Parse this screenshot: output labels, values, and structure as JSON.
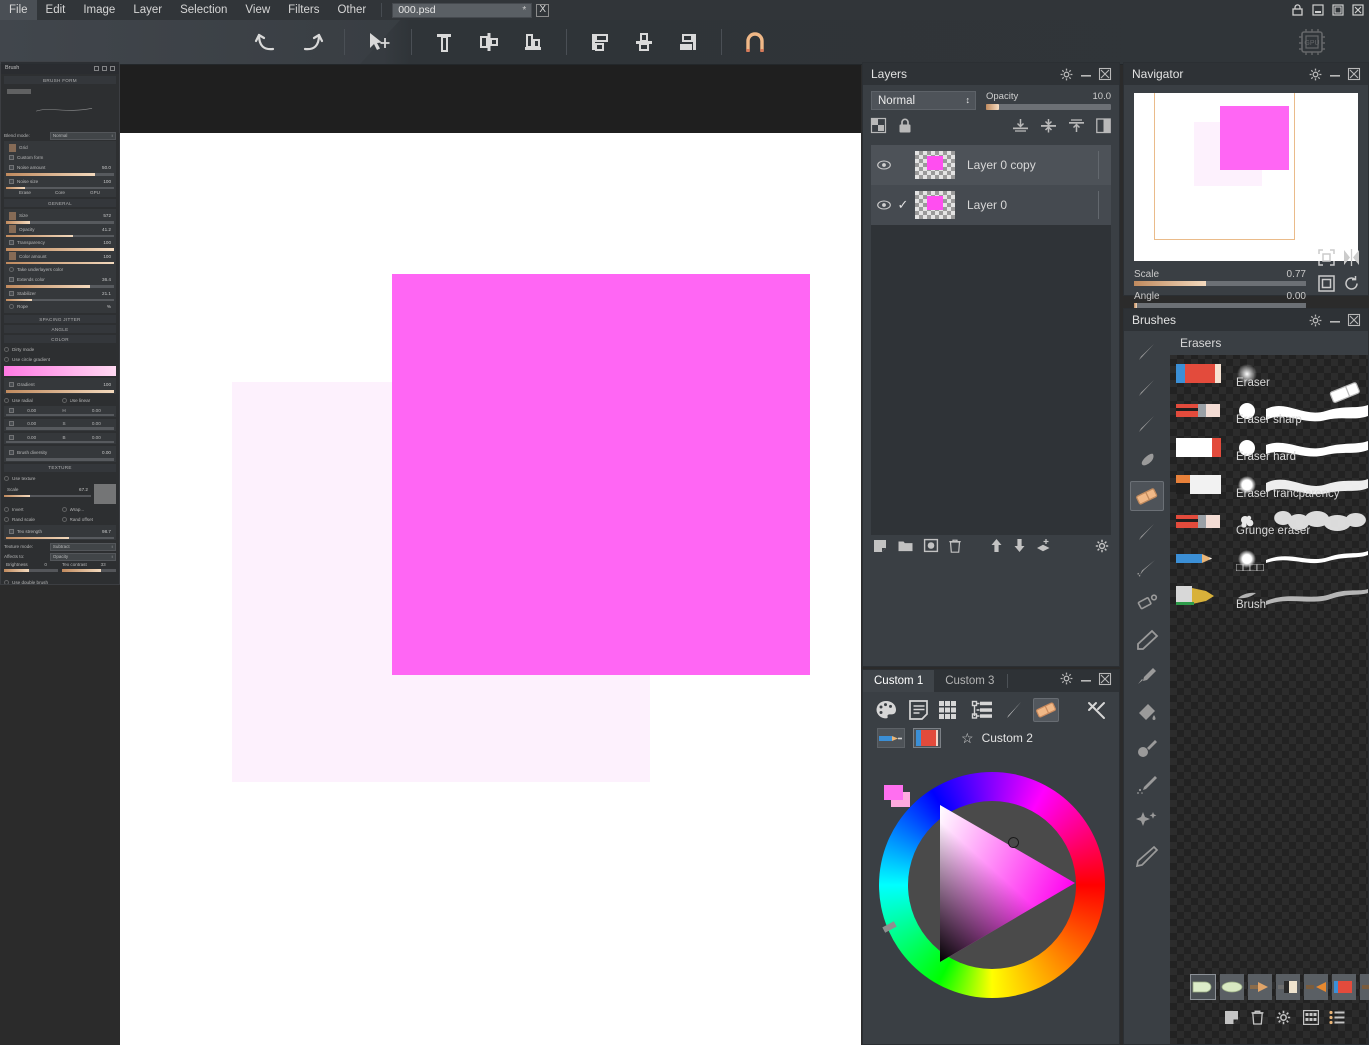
{
  "menu": {
    "items": [
      "File",
      "Edit",
      "Image",
      "Layer",
      "Selection",
      "View",
      "Filters",
      "Other"
    ],
    "document_tab": {
      "filename": "000.psd",
      "modified_marker": "*",
      "close_label": "X"
    }
  },
  "window_controls": {
    "lock": "lock-icon",
    "minimize": "minimize-icon",
    "maximize": "maximize-icon",
    "close": "close-icon"
  },
  "toolbar": {
    "buttons": [
      {
        "name": "undo",
        "label": "Undo"
      },
      {
        "name": "redo",
        "label": "Redo"
      },
      {
        "name": "move-tool",
        "label": "Move"
      },
      {
        "name": "align-left",
        "label": "Align left"
      },
      {
        "name": "align-center-horizontal",
        "label": "Align center horizontally"
      },
      {
        "name": "align-bottom",
        "label": "Align bottom"
      },
      {
        "name": "distribute-left",
        "label": "Distribute left"
      },
      {
        "name": "distribute-center",
        "label": "Distribute center"
      },
      {
        "name": "distribute-right",
        "label": "Distribute right"
      },
      {
        "name": "magnet-snap",
        "label": "Snap"
      }
    ],
    "gpu_badge": "GPU"
  },
  "canvas": {
    "background": "#ffffff",
    "outside_color": "#1f1f1f",
    "shapes": [
      {
        "name": "faded-pink-square",
        "color": "#fdf1fd"
      },
      {
        "name": "magenta-square",
        "color": "#ff66f4"
      }
    ]
  },
  "brush_panel": {
    "title": "Brush",
    "sections": {
      "brush_form": "BRUSH FORM",
      "general": "GENERAL",
      "spacing": "SPACING JITTER",
      "angle": "ANGLE",
      "color": "COLOR",
      "texture": "TEXTURE"
    },
    "blend_mode_label": "Blend mode:",
    "blend_mode_value": "Normal",
    "grid_label": "Grid",
    "custom_form_label": "Custom form",
    "rows_form": [
      {
        "label": "Noise amount",
        "value": "50.0"
      },
      {
        "label": "Noise size",
        "value": "100"
      }
    ],
    "form_buttons": [
      "Erase",
      "Core",
      "GPU"
    ],
    "general_rows": [
      {
        "label": "Size",
        "value": "572"
      },
      {
        "label": "Opacity",
        "value": "41.2"
      },
      {
        "label": "Transparency",
        "value": "100"
      },
      {
        "label": "Color amount",
        "value": "100"
      },
      {
        "label": "Take underlayers color",
        "value": ""
      },
      {
        "label": "Extends color",
        "value": "36.4"
      },
      {
        "label": "Stabilizer",
        "value": "21.1"
      },
      {
        "label": "Rope",
        "value": "%"
      }
    ],
    "color_rows": [
      {
        "label": "Dirty mode",
        "value": ""
      },
      {
        "label": "Use circle gradient",
        "value": ""
      },
      {
        "label": "Gradient",
        "value": "100"
      }
    ],
    "color_modes": [
      "Use radial",
      "Use linear"
    ],
    "hsv_rows": [
      {
        "min": "0.00",
        "channel": "H",
        "max": "0.00"
      },
      {
        "min": "0.00",
        "channel": "S",
        "max": "0.00"
      },
      {
        "min": "0.00",
        "channel": "B",
        "max": "0.00"
      },
      {
        "label": "Brush diversity",
        "value": "0.00"
      }
    ],
    "texture_rows": [
      {
        "label": "Use texture",
        "value": ""
      },
      {
        "label": "Scale",
        "value": "67.2"
      },
      {
        "label": "Tex strength",
        "value": "98.7"
      }
    ],
    "texture_checks": [
      "Invert",
      "Wrap...",
      "Rand scale",
      "Rand offset"
    ],
    "texture_mode_label": "Texture mode:",
    "texture_mode_value": "Subtract",
    "affects_label": "Affects to:",
    "affects_value": "Opacity",
    "brightness_label": "Brightness",
    "brightness_value": "0",
    "contrast_label": "Tex contrast",
    "contrast_value": "33",
    "double_brush_label": "Use double brush"
  },
  "layers": {
    "title": "Layers",
    "blend_mode": "Normal",
    "opacity_label": "Opacity",
    "opacity_value": "10.0",
    "opacity_percent": 10,
    "tool_icons": [
      "transparency-lock-icon",
      "lock-icon",
      "merge-down-icon",
      "merge-selected-icon",
      "merge-up-icon",
      "split-icon"
    ],
    "rows": [
      {
        "name": "Layer 0 copy",
        "visible": true,
        "checked": false,
        "selected": true
      },
      {
        "name": "Layer 0",
        "visible": true,
        "checked": true,
        "selected": false
      }
    ],
    "footer_icons": [
      "new-layer-icon",
      "new-folder-icon",
      "new-mask-icon",
      "delete-layer-icon",
      "move-up-icon",
      "move-down-icon",
      "duplicate-layer-icon",
      "gear-icon"
    ]
  },
  "custom_panel": {
    "tabs": [
      {
        "label": "Custom 1",
        "active": true
      },
      {
        "label": "Custom 3",
        "active": false
      }
    ],
    "toolbar_icons": [
      "palette-icon",
      "notes-icon",
      "swatch-grid-icon",
      "layers-tree-icon",
      "brush-icon",
      "eraser-icon",
      "tools-icon"
    ],
    "selected_toolbar_icon": "eraser-icon",
    "row2_icons": [
      "pencil-swatch-icon",
      "color-swatch-icon",
      "star-icon"
    ],
    "preset_name": "Custom 2",
    "color_wheel": {
      "name": "hsv-color-wheel",
      "foreground": "#ff6ff0",
      "background": "#ffaadf"
    }
  },
  "navigator": {
    "title": "Navigator",
    "scale_label": "Scale",
    "scale_value": "0.77",
    "scale_percent": 42,
    "angle_label": "Angle",
    "angle_value": "0.00",
    "angle_percent": 1,
    "buttons": [
      "fit-to-view-icon",
      "flip-horizontal-icon",
      "actual-size-icon",
      "reset-rotation-icon"
    ]
  },
  "brushes": {
    "title": "Brushes",
    "category": "Erasers",
    "sidebar_icons": [
      "brush-thin-icon",
      "brush-flat-icon",
      "brush-round-icon",
      "blob-icon",
      "eraser-icon",
      "ink-pen-icon",
      "airbrush-icon",
      "paintbrush-icon",
      "pencil-icon",
      "marker-icon",
      "bucket-icon",
      "smudge-icon",
      "spray-icon",
      "sparkle-icon",
      "nib-icon"
    ],
    "selected_sidebar_icon": "eraser-icon",
    "items": [
      {
        "name": "Eraser",
        "thumb": "eraser-block-blue-red"
      },
      {
        "name": "Eraser sharp",
        "thumb": "pencil-eraser"
      },
      {
        "name": "Eraser hard",
        "thumb": "white-red-block"
      },
      {
        "name": "Eraser trancparency",
        "thumb": "white-orange-block"
      },
      {
        "name": "Grunge eraser",
        "thumb": "pencil-eraser"
      },
      {
        "name": "□□□□",
        "thumb": "blue-pencil"
      },
      {
        "name": "Brush",
        "thumb": "gold-brush"
      }
    ],
    "presets": [
      "preset-green-round",
      "preset-green-oval",
      "preset-tan-fan",
      "preset-flat-grey",
      "preset-orange-fan",
      "preset-block-redblue",
      "preset-orange-wide"
    ],
    "selected_preset_index": 0,
    "footer_icons": [
      "new-brush-icon",
      "delete-brush-icon",
      "gear-icon",
      "thumbnail-view-icon",
      "list-view-icon"
    ]
  }
}
